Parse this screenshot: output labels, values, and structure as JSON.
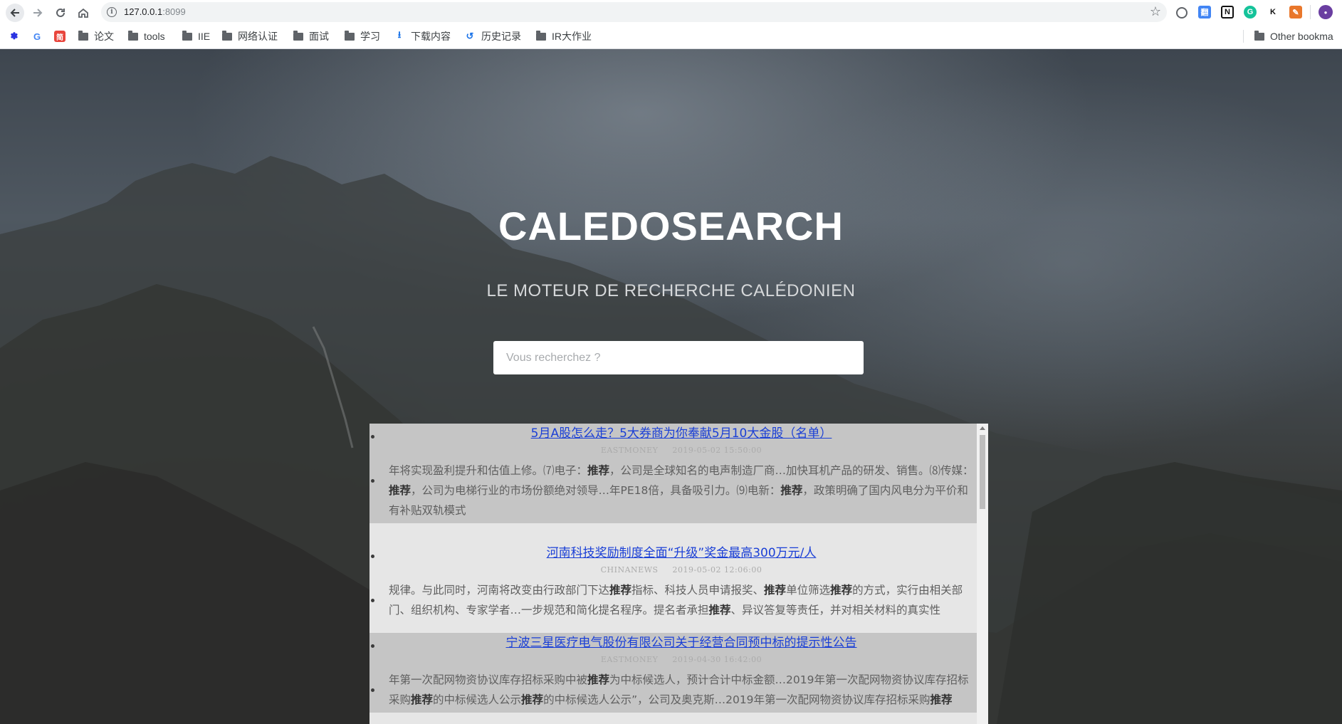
{
  "browser": {
    "url_host": "127.0.0.1",
    "url_port": ":8099",
    "extensions": [
      "K",
      "百",
      "G",
      "N",
      "K",
      "翻"
    ]
  },
  "bookmarks": {
    "items": [
      {
        "label": "论文"
      },
      {
        "label": "tools"
      },
      {
        "label": "IIE"
      },
      {
        "label": "网络认证"
      },
      {
        "label": "面试"
      },
      {
        "label": "学习"
      },
      {
        "label": "下载内容"
      },
      {
        "label": "历史记录"
      },
      {
        "label": "IR大作业"
      }
    ],
    "other": "Other bookma"
  },
  "hero": {
    "title": "CALEDOSEARCH",
    "subtitle": "LE MOTEUR DE RECHERCHE CALÉDONIEN",
    "search_placeholder": "Vous recherchez ?"
  },
  "results": [
    {
      "title": "5月A股怎么走？5大券商为你奉献5月10大金股（名单）",
      "source": "EASTMONEY",
      "date": "2019-05-02 15:50:00",
      "snippet_parts": [
        {
          "t": "年将实现盈利提升和估值上修。⑺电子："
        },
        {
          "t": "推荐",
          "b": true
        },
        {
          "t": "，公司是全球知名的电声制造厂商…加快耳机产品的研发、销售。⑻传媒："
        },
        {
          "t": "推荐",
          "b": true
        },
        {
          "t": "，公司为电梯行业的市场份额绝对领导…年PE18倍，具备吸引力。⑼电新："
        },
        {
          "t": "推荐",
          "b": true
        },
        {
          "t": "，政策明确了国内风电分为平价和有补贴双轨模式"
        }
      ]
    },
    {
      "title": "河南科技奖励制度全面“升级”奖金最高300万元/人",
      "source": "CHINANEWS",
      "date": "2019-05-02 12:06:00",
      "snippet_parts": [
        {
          "t": "规律。与此同时，河南将改变由行政部门下达"
        },
        {
          "t": "推荐",
          "b": true
        },
        {
          "t": "指标、科技人员申请报奖、"
        },
        {
          "t": "推荐",
          "b": true
        },
        {
          "t": "单位筛选"
        },
        {
          "t": "推荐",
          "b": true
        },
        {
          "t": "的方式，实行由相关部门、组织机构、专家学者…一步规范和简化提名程序。提名者承担"
        },
        {
          "t": "推荐",
          "b": true
        },
        {
          "t": "、异议答复等责任，并对相关材料的真实性"
        }
      ]
    },
    {
      "title": "宁波三星医疗电气股份有限公司关于经营合同预中标的提示性公告",
      "source": "EASTMONEY",
      "date": "2019-04-30 16:42:00",
      "snippet_parts": [
        {
          "t": "年第一次配网物资协议库存招标采购中被"
        },
        {
          "t": "推荐",
          "b": true
        },
        {
          "t": "为中标候选人，预计合计中标金额…2019年第一次配网物资协议库存招标采购"
        },
        {
          "t": "推荐",
          "b": true
        },
        {
          "t": "的中标候选人公示"
        },
        {
          "t": "推荐",
          "b": true
        },
        {
          "t": "的中标候选人公示”，公司及奥克斯…2019年第一次配网物资协议库存招标采购"
        },
        {
          "t": "推荐",
          "b": true
        }
      ]
    }
  ]
}
